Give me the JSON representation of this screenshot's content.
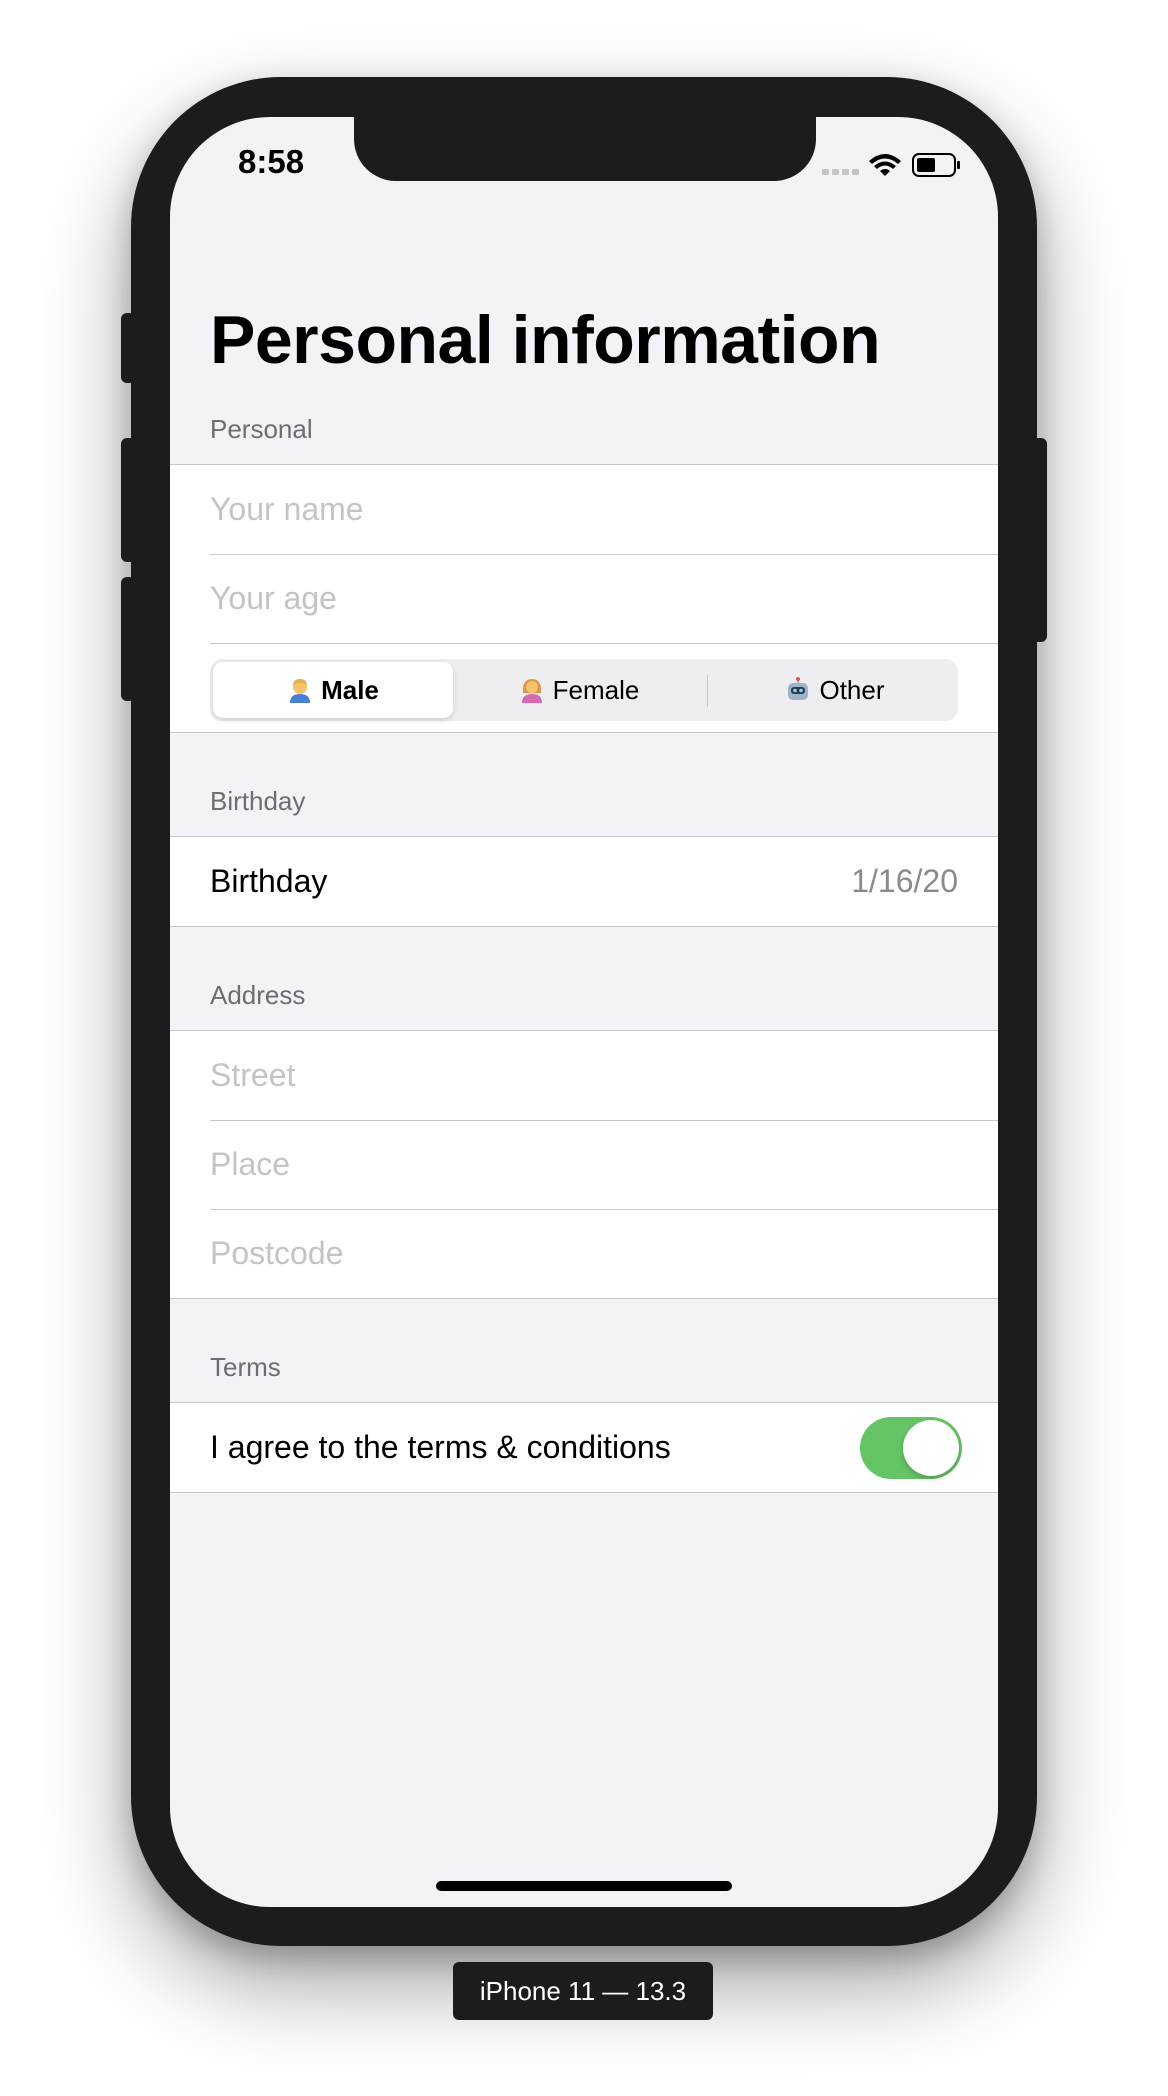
{
  "status_bar": {
    "time": "8:58",
    "signal_icon": "cellular-dots-icon",
    "wifi_icon": "wifi-icon",
    "battery_icon": "battery-icon"
  },
  "nav": {
    "title": "Personal information"
  },
  "sections": {
    "personal": {
      "header": "Personal",
      "name_placeholder": "Your name",
      "age_placeholder": "Your age",
      "gender_options": [
        {
          "label": "Male",
          "icon": "man-emoji-icon",
          "selected": true
        },
        {
          "label": "Female",
          "icon": "woman-emoji-icon",
          "selected": false
        },
        {
          "label": "Other",
          "icon": "robot-emoji-icon",
          "selected": false
        }
      ]
    },
    "birthday": {
      "header": "Birthday",
      "label": "Birthday",
      "value": "1/16/20"
    },
    "address": {
      "header": "Address",
      "street_placeholder": "Street",
      "place_placeholder": "Place",
      "postcode_placeholder": "Postcode"
    },
    "terms": {
      "header": "Terms",
      "label": "I agree to the terms & conditions",
      "toggle_on": true
    }
  },
  "simulator": {
    "device_label": "iPhone 11 — 13.3"
  },
  "colors": {
    "toggle_on": "#65c466",
    "background": "#f2f2f7",
    "separator": "#c8c7cc",
    "placeholder": "#c4c4c7"
  }
}
